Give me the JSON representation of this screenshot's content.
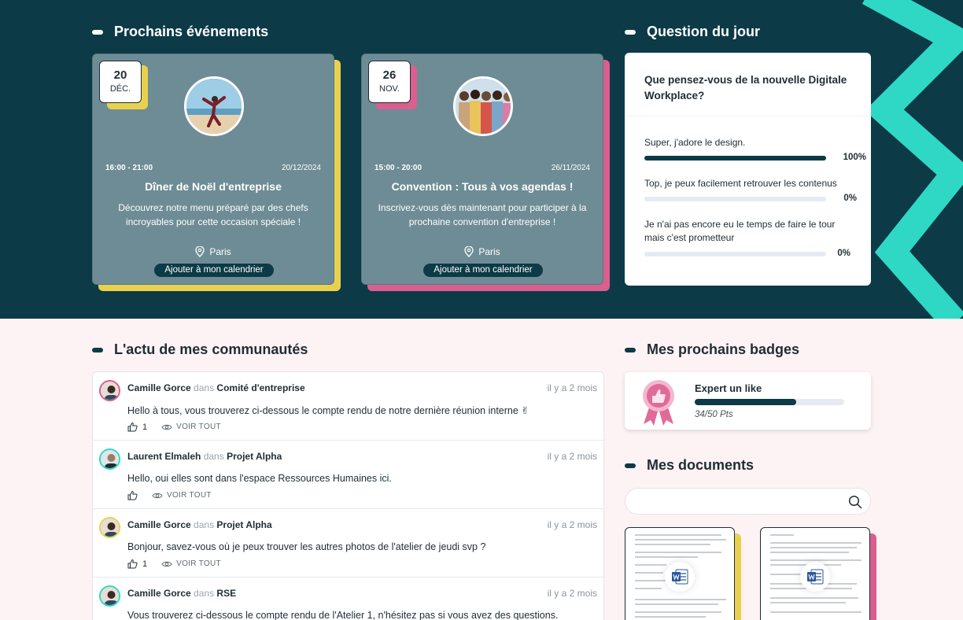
{
  "events_section": {
    "title": "Prochains événements"
  },
  "events": [
    {
      "day": "20",
      "month": "DÉC.",
      "time": "16:00 - 21:00",
      "date": "20/12/2024",
      "title": "Dîner de Noël d'entreprise",
      "description": "Découvrez notre menu préparé par des chefs incroyables pour cette occasion spéciale !",
      "location": "Paris",
      "button": "Ajouter à mon calendrier",
      "accent": "#e8d14e"
    },
    {
      "day": "26",
      "month": "NOV.",
      "time": "15:00 - 20:00",
      "date": "26/11/2024",
      "title": "Convention : Tous à vos agendas !",
      "description": "Inscrivez-vous dès maintenant pour participer à la prochaine convention d'entreprise !",
      "location": "Paris",
      "button": "Ajouter à mon calendrier",
      "accent": "#d95f8f"
    }
  ],
  "question": {
    "section_title": "Question du jour",
    "text": "Que pensez-vous de la nouvelle Digitale Workplace?",
    "answers": [
      {
        "text": "Super, j'adore le design.",
        "percent": "100%",
        "fraction": 1.0
      },
      {
        "text": "Top, je peux facilement retrouver les contenus",
        "percent": "0%",
        "fraction": 0.0
      },
      {
        "text": "Je n'ai pas encore eu le temps de faire le tour mais c'est prometteur",
        "percent": "0%",
        "fraction": 0.0
      }
    ]
  },
  "feed": {
    "title": "L'actu de mes communautés",
    "in_word": "dans",
    "view_all": "VOIR TOUT",
    "posts": [
      {
        "author": "Camille Gorce",
        "space": "Comité d'entreprise",
        "time": "il y a 2 mois",
        "text": "Hello à tous, vous trouverez ci-dessous le compte rendu de notre dernière réunion interne ✌",
        "likes": "1"
      },
      {
        "author": "Laurent Elmaleh",
        "space": "Projet Alpha",
        "time": "il y a 2 mois",
        "text": "Hello, oui elles sont dans l'espace Ressources Humaines ",
        "link": "ici",
        "tail": ".",
        "likes": ""
      },
      {
        "author": "Camille Gorce",
        "space": "Projet Alpha",
        "time": "il y a 2 mois",
        "text": "Bonjour, savez-vous où je peux trouver les autres photos de l'atelier de jeudi svp ?",
        "likes": "1"
      },
      {
        "author": "Camille Gorce",
        "space": "RSE",
        "time": "il y a 2 mois",
        "text": "Vous trouverez ci-dessous le compte rendu de l'Atelier 1, n'hésitez pas si vous avez des questions.",
        "likes": ""
      }
    ]
  },
  "badges": {
    "title": "Mes prochains badges",
    "name": "Expert un like",
    "points": "34/50 Pts",
    "progress": 0.68
  },
  "documents": {
    "title": "Mes documents",
    "search_placeholder": "",
    "items": [
      {
        "accent": "#e8d14e"
      },
      {
        "accent": "#d95f8f"
      }
    ]
  },
  "colors": {
    "dark": "#0c3a47",
    "teal_deco": "#2fd8c4",
    "card": "#6e8c95"
  }
}
